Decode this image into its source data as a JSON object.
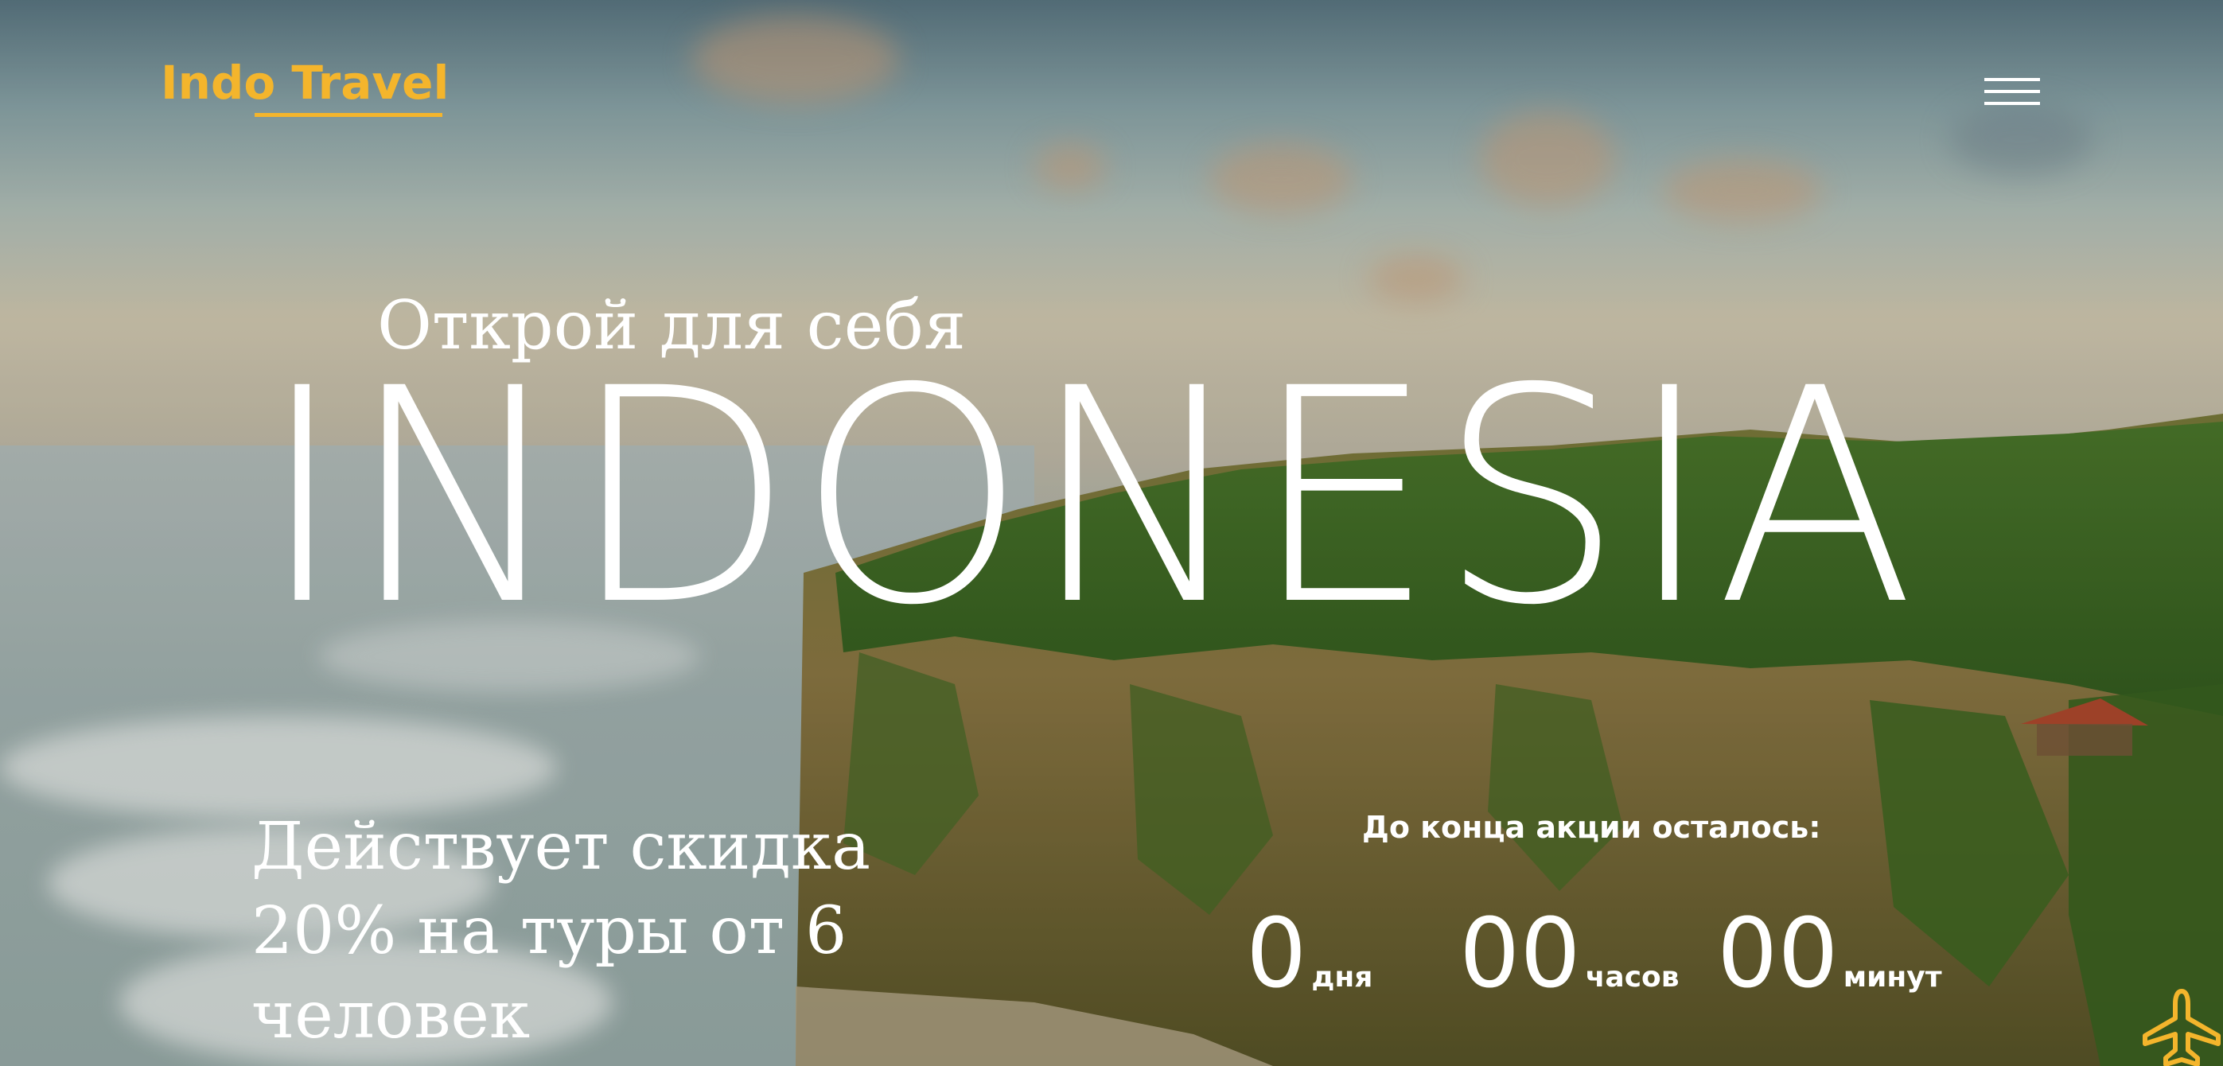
{
  "header": {
    "logo_text": "Indo Travel",
    "menu_icon": "hamburger-icon"
  },
  "hero": {
    "subtitle": "Открой для себя",
    "title": "INDONESIA",
    "promo_text": "Действует скидка 20% на туры от 6 человек"
  },
  "countdown": {
    "label": "До конца акции осталось:",
    "days_value": "0",
    "days_unit": "дня",
    "hours_value": "00",
    "hours_unit": "часов",
    "minutes_value": "00",
    "minutes_unit": "минут"
  },
  "floating": {
    "icon": "airplane-icon"
  },
  "colors": {
    "accent": "#f4b52c",
    "text": "#ffffff"
  }
}
